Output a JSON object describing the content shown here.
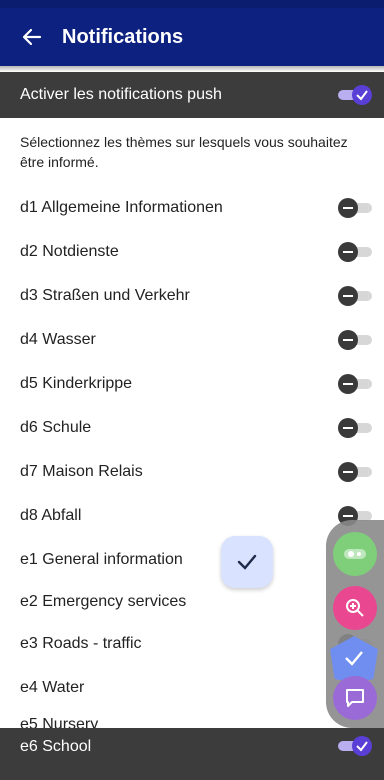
{
  "appbar": {
    "title": "Notifications"
  },
  "master": {
    "label": "Activer les notifications push",
    "enabled": true
  },
  "description": "Sélectionnez les thèmes sur lesquels vous souhaitez être informé.",
  "topics": [
    {
      "label": "d1 Allgemeine Informationen",
      "enabled": false
    },
    {
      "label": "d2 Notdienste",
      "enabled": false
    },
    {
      "label": "d3 Straßen und Verkehr",
      "enabled": false
    },
    {
      "label": "d4 Wasser",
      "enabled": false
    },
    {
      "label": "d5 Kinderkrippe",
      "enabled": false
    },
    {
      "label": "d6 Schule",
      "enabled": false
    },
    {
      "label": "d7 Maison Relais",
      "enabled": false
    },
    {
      "label": "d8 Abfall",
      "enabled": false
    },
    {
      "label": "e1 General information",
      "enabled": false
    },
    {
      "label": "e2 Emergency services",
      "enabled": false
    },
    {
      "label": "e3 Roads - traffic",
      "enabled": false
    },
    {
      "label": "e4 Water",
      "enabled": false
    },
    {
      "label": "e5 Nursery",
      "enabled": false
    },
    {
      "label": "e6 School",
      "enabled": true
    }
  ],
  "icons": {
    "back": "arrow-left-icon",
    "fab": "check-icon",
    "speed_dial": [
      "record-icon",
      "zoom-in-icon",
      "check-icon",
      "chat-icon"
    ]
  },
  "colors": {
    "appbar": "#0d2180",
    "accent": "#5a3fd6",
    "dark_row": "#3c3c3c"
  }
}
